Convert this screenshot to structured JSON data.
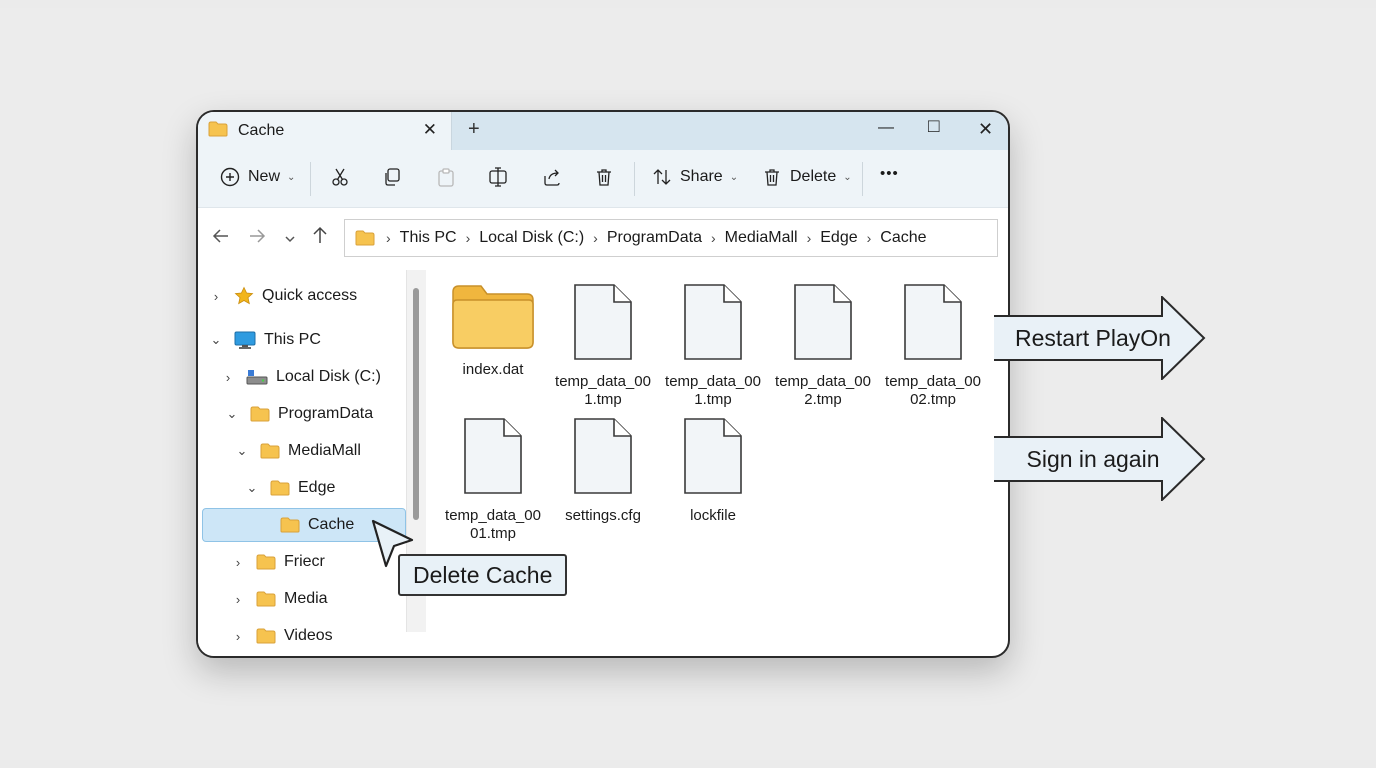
{
  "window": {
    "tab_title": "Cache",
    "new_tab": "+",
    "tab_close": "✕",
    "minimize": "—",
    "maximize": "□",
    "close": "✕"
  },
  "toolbar": {
    "new_label": "New",
    "share_label": "Share",
    "delete_label": "Delete",
    "more": "•••"
  },
  "breadcrumb": [
    "This PC",
    "Local Disk (C:)",
    "ProgramData",
    "MediaMall",
    "Edge",
    "Cache"
  ],
  "sidebar": {
    "items": [
      {
        "label": "Quick access",
        "chevron": "›",
        "icon": "star-icon"
      },
      {
        "label": "This PC",
        "chevron": "⌄",
        "icon": "computer-icon"
      },
      {
        "label": "Local Disk (C:)",
        "chevron": "›",
        "icon": "drive-icon"
      },
      {
        "label": "ProgramData",
        "chevron": "⌄",
        "icon": "folder-icon"
      },
      {
        "label": "MediaMall",
        "chevron": "⌄",
        "icon": "folder-icon"
      },
      {
        "label": "Edge",
        "chevron": "⌄",
        "icon": "folder-icon"
      },
      {
        "label": "Cache",
        "chevron": "",
        "icon": "folder-icon"
      },
      {
        "label": "Friecr",
        "chevron": "›",
        "icon": "folder-icon"
      },
      {
        "label": "Media",
        "chevron": "›",
        "icon": "folder-icon"
      },
      {
        "label": "Videos",
        "chevron": "›",
        "icon": "folder-icon"
      }
    ]
  },
  "files": [
    {
      "name": "index.dat",
      "icon": "folder-icon"
    },
    {
      "name": "temp_data_001.tmp",
      "icon": "file-icon"
    },
    {
      "name": "temp_data_001.tmp",
      "icon": "file-icon"
    },
    {
      "name": "temp_data_002.tmp",
      "icon": "file-icon"
    },
    {
      "name": "temp_data_0002.tmp",
      "icon": "file-icon"
    },
    {
      "name": "temp_data_0001.tmp",
      "icon": "file-icon"
    },
    {
      "name": "settings.cfg",
      "icon": "file-icon"
    },
    {
      "name": "lockfile",
      "icon": "file-icon"
    }
  ],
  "annotations": {
    "delete_cache": "Delete Cache",
    "restart": "Restart PlayOn",
    "sign_in": "Sign in again"
  },
  "colors": {
    "accent": "#cde6f7",
    "titlebar": "#d6e5ef",
    "folder": "#f6c34f",
    "callout_bg": "#e8f1f7"
  }
}
